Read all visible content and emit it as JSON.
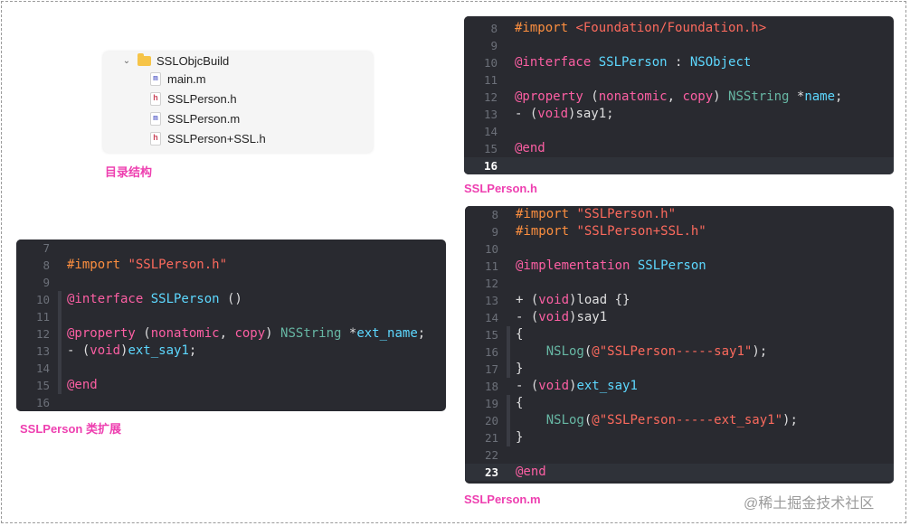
{
  "file_tree": {
    "folder": "SSLObjcBuild",
    "files": [
      {
        "name": "main.m",
        "badge": "m"
      },
      {
        "name": "SSLPerson.h",
        "badge": "h"
      },
      {
        "name": "SSLPerson.m",
        "badge": "m"
      },
      {
        "name": "SSLPerson+SSL.h",
        "badge": "h"
      }
    ],
    "caption": "目录结构"
  },
  "header_panel": {
    "caption": "SSLPerson.h",
    "current_line": "16",
    "lines": [
      {
        "n": "8",
        "tokens": [
          [
            "#import ",
            "pre"
          ],
          [
            "<Foundation/Foundation.h>",
            "str"
          ]
        ]
      },
      {
        "n": "9",
        "tokens": []
      },
      {
        "n": "10",
        "tokens": [
          [
            "@interface ",
            "kw"
          ],
          [
            "SSLPerson",
            "type"
          ],
          [
            " : ",
            "plain"
          ],
          [
            "NSObject",
            "type"
          ]
        ]
      },
      {
        "n": "11",
        "tokens": []
      },
      {
        "n": "12",
        "tokens": [
          [
            "@property ",
            "kw"
          ],
          [
            "(",
            "plain"
          ],
          [
            "nonatomic",
            "kw"
          ],
          [
            ", ",
            "plain"
          ],
          [
            "copy",
            "kw"
          ],
          [
            ") ",
            "plain"
          ],
          [
            "NSString",
            "id"
          ],
          [
            " *",
            "plain"
          ],
          [
            "name",
            "type"
          ],
          [
            ";",
            "plain"
          ]
        ]
      },
      {
        "n": "13",
        "tokens": [
          [
            "- (",
            "plain"
          ],
          [
            "void",
            "kw"
          ],
          [
            ")say1;",
            "plain"
          ]
        ]
      },
      {
        "n": "14",
        "tokens": []
      },
      {
        "n": "15",
        "tokens": [
          [
            "@end",
            "kw"
          ]
        ]
      },
      {
        "n": "16",
        "tokens": []
      }
    ]
  },
  "extension_panel": {
    "caption": "SSLPerson 类扩展",
    "lines": [
      {
        "n": "7",
        "tokens": []
      },
      {
        "n": "8",
        "tokens": [
          [
            "#import ",
            "pre"
          ],
          [
            "\"SSLPerson.h\"",
            "str"
          ]
        ]
      },
      {
        "n": "9",
        "tokens": []
      },
      {
        "n": "10",
        "tokens": [
          [
            "@interface ",
            "kw"
          ],
          [
            "SSLPerson",
            "type"
          ],
          [
            " ()",
            "plain"
          ]
        ]
      },
      {
        "n": "11",
        "tokens": []
      },
      {
        "n": "12",
        "tokens": [
          [
            "@property ",
            "kw"
          ],
          [
            "(",
            "plain"
          ],
          [
            "nonatomic",
            "kw"
          ],
          [
            ", ",
            "plain"
          ],
          [
            "copy",
            "kw"
          ],
          [
            ") ",
            "plain"
          ],
          [
            "NSString",
            "id"
          ],
          [
            " *",
            "plain"
          ],
          [
            "ext_name",
            "type"
          ],
          [
            ";",
            "plain"
          ]
        ]
      },
      {
        "n": "13",
        "tokens": [
          [
            "- (",
            "plain"
          ],
          [
            "void",
            "kw"
          ],
          [
            ")",
            "plain"
          ],
          [
            "ext_say1",
            "type"
          ],
          [
            ";",
            "plain"
          ]
        ]
      },
      {
        "n": "14",
        "tokens": []
      },
      {
        "n": "15",
        "tokens": [
          [
            "@end",
            "kw"
          ]
        ]
      },
      {
        "n": "16",
        "tokens": []
      }
    ]
  },
  "impl_panel": {
    "caption": "SSLPerson.m",
    "current_line": "23",
    "lines": [
      {
        "n": "8",
        "tokens": [
          [
            "#import ",
            "pre"
          ],
          [
            "\"SSLPerson.h\"",
            "str"
          ]
        ]
      },
      {
        "n": "9",
        "tokens": [
          [
            "#import ",
            "pre"
          ],
          [
            "\"SSLPerson+SSL.h\"",
            "str"
          ]
        ]
      },
      {
        "n": "10",
        "tokens": []
      },
      {
        "n": "11",
        "tokens": [
          [
            "@implementation ",
            "kw"
          ],
          [
            "SSLPerson",
            "type"
          ]
        ]
      },
      {
        "n": "12",
        "tokens": []
      },
      {
        "n": "13",
        "tokens": [
          [
            "+ (",
            "plain"
          ],
          [
            "void",
            "kw"
          ],
          [
            ")load {}",
            "plain"
          ]
        ]
      },
      {
        "n": "14",
        "tokens": [
          [
            "- (",
            "plain"
          ],
          [
            "void",
            "kw"
          ],
          [
            ")say1",
            "plain"
          ]
        ]
      },
      {
        "n": "15",
        "tokens": [
          [
            "{",
            "plain"
          ]
        ]
      },
      {
        "n": "16",
        "tokens": [
          [
            "    NSLog",
            "id"
          ],
          [
            "(",
            "plain"
          ],
          [
            "@\"SSLPerson-----say1\"",
            "str"
          ],
          [
            ");",
            "plain"
          ]
        ]
      },
      {
        "n": "17",
        "tokens": [
          [
            "}",
            "plain"
          ]
        ]
      },
      {
        "n": "18",
        "tokens": [
          [
            "- (",
            "plain"
          ],
          [
            "void",
            "kw"
          ],
          [
            ")",
            "plain"
          ],
          [
            "ext_say1",
            "type"
          ]
        ]
      },
      {
        "n": "19",
        "tokens": [
          [
            "{",
            "plain"
          ]
        ]
      },
      {
        "n": "20",
        "tokens": [
          [
            "    NSLog",
            "id"
          ],
          [
            "(",
            "plain"
          ],
          [
            "@\"SSLPerson-----ext_say1\"",
            "str"
          ],
          [
            ");",
            "plain"
          ]
        ]
      },
      {
        "n": "21",
        "tokens": [
          [
            "}",
            "plain"
          ]
        ]
      },
      {
        "n": "22",
        "tokens": []
      },
      {
        "n": "23",
        "tokens": [
          [
            "@end",
            "kw"
          ]
        ]
      }
    ]
  },
  "watermark": "@稀土掘金技术社区"
}
